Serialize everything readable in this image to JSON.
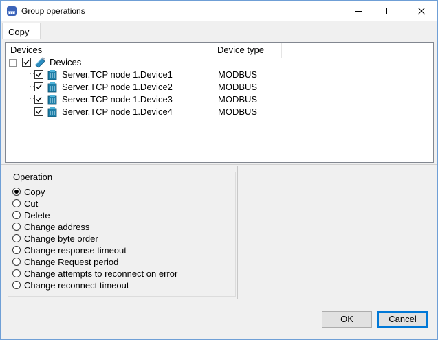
{
  "window": {
    "title": "Group operations"
  },
  "tabs": [
    {
      "label": "Copy"
    }
  ],
  "tree": {
    "columns": [
      "Devices",
      "Device type"
    ],
    "root": {
      "label": "Devices",
      "checked": true,
      "icon": "devices-icon"
    },
    "children": [
      {
        "label": "Server.TCP node 1.Device1",
        "type": "MODBUS",
        "checked": true,
        "icon": "device-icon"
      },
      {
        "label": "Server.TCP node 1.Device2",
        "type": "MODBUS",
        "checked": true,
        "icon": "device-icon"
      },
      {
        "label": "Server.TCP node 1.Device3",
        "type": "MODBUS",
        "checked": true,
        "icon": "device-icon"
      },
      {
        "label": "Server.TCP node 1.Device4",
        "type": "MODBUS",
        "checked": true,
        "icon": "device-icon"
      }
    ]
  },
  "operation": {
    "title": "Operation",
    "options": [
      {
        "label": "Copy",
        "selected": true
      },
      {
        "label": "Cut",
        "selected": false
      },
      {
        "label": "Delete",
        "selected": false
      },
      {
        "label": "Change address",
        "selected": false
      },
      {
        "label": "Change byte order",
        "selected": false
      },
      {
        "label": "Change response timeout",
        "selected": false
      },
      {
        "label": "Change Request period",
        "selected": false
      },
      {
        "label": "Change attempts to reconnect on error",
        "selected": false
      },
      {
        "label": "Change reconnect timeout",
        "selected": false
      }
    ]
  },
  "buttons": {
    "ok": "OK",
    "cancel": "Cancel"
  },
  "colors": {
    "accent": "#0078d7",
    "device_icon": "#1e7fa8"
  }
}
